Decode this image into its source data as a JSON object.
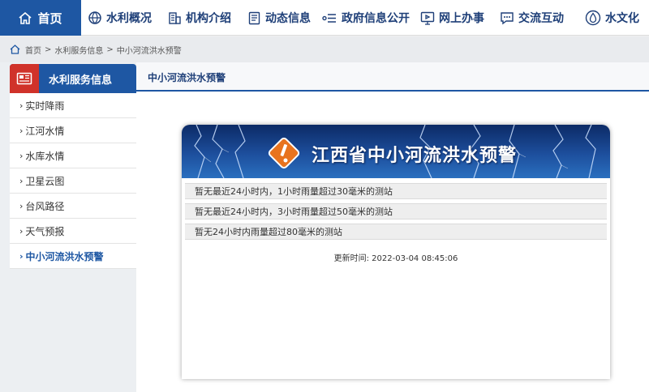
{
  "nav": {
    "home": "首页",
    "items": [
      "水利概况",
      "机构介绍",
      "动态信息",
      "政府信息公开",
      "网上办事",
      "交流互动",
      "水文化"
    ]
  },
  "breadcrumb": {
    "items": [
      "首页",
      "水利服务信息",
      "中小河流洪水预警"
    ],
    "separator": ">"
  },
  "sidebar": {
    "title": "水利服务信息",
    "items": [
      "实时降雨",
      "江河水情",
      "水库水情",
      "卫星云图",
      "台风路径",
      "天气预报",
      "中小河流洪水预警"
    ],
    "active_index": 6
  },
  "main": {
    "title": "中小河流洪水预警"
  },
  "warning": {
    "banner_title": "江西省中小河流洪水预警",
    "rows": [
      "暂无最近24小时内，1小时雨量超过30毫米的测站",
      "暂无最近24小时内，3小时雨量超过50毫米的测站",
      "暂无24小时内雨量超过80毫米的测站"
    ],
    "update_label": "更新时间:",
    "update_time": "2022-03-04 08:45:06"
  },
  "colors": {
    "primary": "#1e57a3",
    "accent_red": "#d0322a",
    "warning_orange": "#e8731e"
  }
}
